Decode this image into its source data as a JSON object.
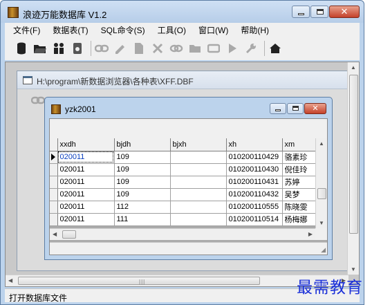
{
  "app": {
    "title": "浪迹万能数据库 V1.2"
  },
  "menu": [
    "文件(F)",
    "数据表(T)",
    "SQL命令(S)",
    "工具(O)",
    "窗口(W)",
    "帮助(H)"
  ],
  "toolbar": {
    "icons": [
      {
        "name": "database-icon",
        "glyph": "db",
        "disabled": false
      },
      {
        "name": "open-folder-icon",
        "glyph": "folder-open",
        "disabled": false
      },
      {
        "name": "users-icon",
        "glyph": "users",
        "disabled": false
      },
      {
        "name": "phone-icon",
        "glyph": "phone",
        "disabled": false
      },
      {
        "name": "chain-link-icon",
        "glyph": "link",
        "disabled": true
      },
      {
        "name": "pencil-icon",
        "glyph": "pencil",
        "disabled": true
      },
      {
        "name": "document-icon",
        "glyph": "doc",
        "disabled": true
      },
      {
        "name": "delete-x-icon",
        "glyph": "x",
        "disabled": true
      },
      {
        "name": "chain-icon",
        "glyph": "chain",
        "disabled": true
      },
      {
        "name": "folder-icon",
        "glyph": "folder",
        "disabled": true
      },
      {
        "name": "window-icon",
        "glyph": "window",
        "disabled": true
      },
      {
        "name": "play-icon",
        "glyph": "play",
        "disabled": true
      },
      {
        "name": "wrench-icon",
        "glyph": "wrench",
        "disabled": true
      },
      {
        "name": "home-icon",
        "glyph": "home",
        "disabled": false
      }
    ]
  },
  "child_window_1": {
    "title": "H:\\program\\新数据浏览器\\各种表\\XFF.DBF"
  },
  "child_window_2": {
    "title": "yzk2001",
    "columns": [
      "xxdh",
      "bjdh",
      "bjxh",
      "xh",
      "xm"
    ],
    "rows": [
      [
        "020011",
        "109",
        "",
        "010200110429",
        "骆素珍"
      ],
      [
        "020011",
        "109",
        "",
        "010200110430",
        "倪佳玲"
      ],
      [
        "020011",
        "109",
        "",
        "010200110431",
        "苏婷"
      ],
      [
        "020011",
        "109",
        "",
        "010200110432",
        "吴梦"
      ],
      [
        "020011",
        "112",
        "",
        "010200110555",
        "陈晓雯"
      ],
      [
        "020011",
        "111",
        "",
        "010200110514",
        "杨梅娜"
      ]
    ]
  },
  "status": {
    "text": "打开数据库文件"
  },
  "watermark": "最需教育"
}
